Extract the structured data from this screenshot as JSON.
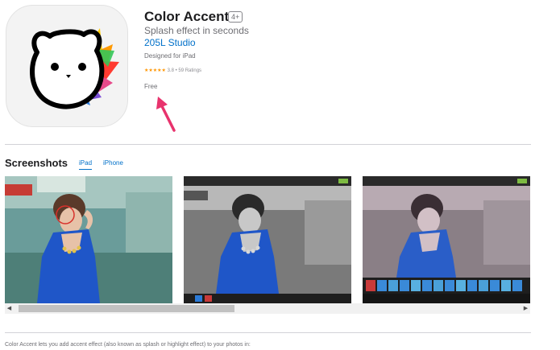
{
  "app": {
    "icon": "bear-face-rainbow-splash-icon",
    "title": "Color Accent",
    "age_rating": "4+",
    "subtitle": "Splash effect in seconds",
    "developer": "205L Studio",
    "designed_for": "Designed for iPad",
    "rating": {
      "stars": "★★★★★",
      "value": 3.8,
      "text": "3.8 • 59 Ratings"
    },
    "price": "Free"
  },
  "annotation": {
    "icon": "pink-arrow-icon",
    "color": "#e8336d"
  },
  "screenshots": {
    "title": "Screenshots",
    "tabs": [
      {
        "label": "iPad",
        "active": true
      },
      {
        "label": "iPhone",
        "active": false
      }
    ],
    "items": [
      {
        "name": "screenshot-color-original",
        "style": "color"
      },
      {
        "name": "screenshot-grayscale-edit",
        "style": "grayscale"
      },
      {
        "name": "screenshot-filter-strip",
        "style": "tinted"
      }
    ],
    "scroll_left_icon": "◀",
    "scroll_right_icon": "▶"
  },
  "description": "Color Accent lets you add accent effect (also known as splash or highlight effect) to your photos in:",
  "colors": {
    "link": "#0070c9",
    "star": "#ff9500",
    "divider": "#d2d2d7"
  }
}
